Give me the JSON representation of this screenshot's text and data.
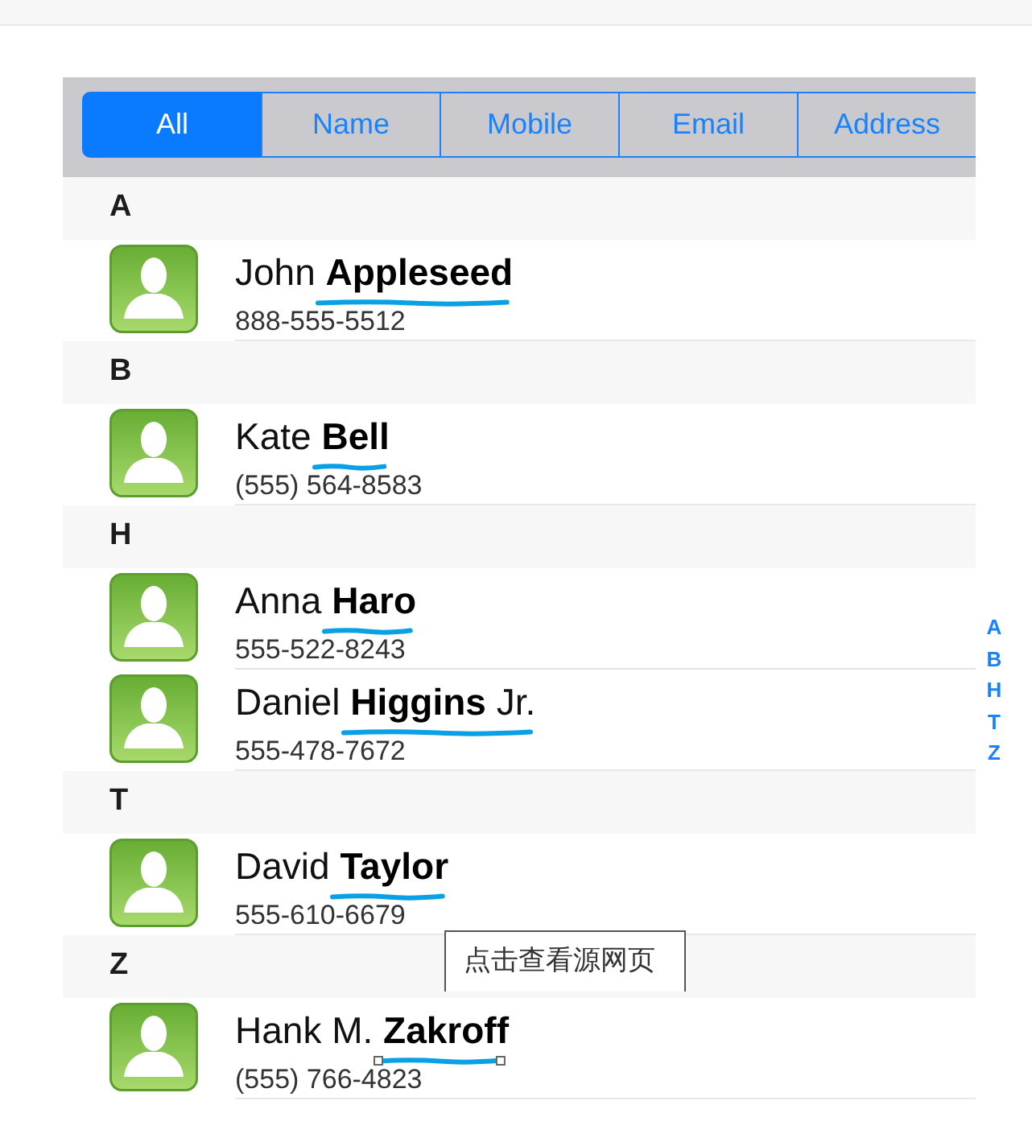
{
  "scope_bar": {
    "segments": [
      {
        "label": "All",
        "selected": true
      },
      {
        "label": "Name",
        "selected": false
      },
      {
        "label": "Mobile",
        "selected": false
      },
      {
        "label": "Email",
        "selected": false
      },
      {
        "label": "Address",
        "selected": false
      }
    ]
  },
  "sections": [
    {
      "letter": "A",
      "contacts": [
        {
          "name": "John **Appleseed**",
          "phone": "888-555-5512",
          "underlined": true,
          "underline_handles": false
        }
      ]
    },
    {
      "letter": "B",
      "contacts": [
        {
          "name": "Kate **Bell**",
          "phone": "(555) 564-8583",
          "underlined": true,
          "underline_handles": false
        }
      ]
    },
    {
      "letter": "H",
      "contacts": [
        {
          "name": "Anna **Haro**",
          "phone": "555-522-8243",
          "underlined": true,
          "underline_handles": false
        },
        {
          "name": "Daniel **Higgins** Jr.",
          "phone": "555-478-7672",
          "underlined": true,
          "underline_handles": false
        }
      ]
    },
    {
      "letter": "T",
      "contacts": [
        {
          "name": "David **Taylor**",
          "phone": "555-610-6679",
          "underlined": true,
          "underline_handles": false
        }
      ]
    },
    {
      "letter": "Z",
      "contacts": [
        {
          "name": "Hank M. **Zakroff**",
          "phone": "(555) 766-4823",
          "underlined": true,
          "underline_handles": true
        }
      ]
    }
  ],
  "section_index": [
    "A",
    "B",
    "H",
    "T",
    "Z"
  ],
  "tooltip": {
    "text": "点击查看源网页"
  }
}
